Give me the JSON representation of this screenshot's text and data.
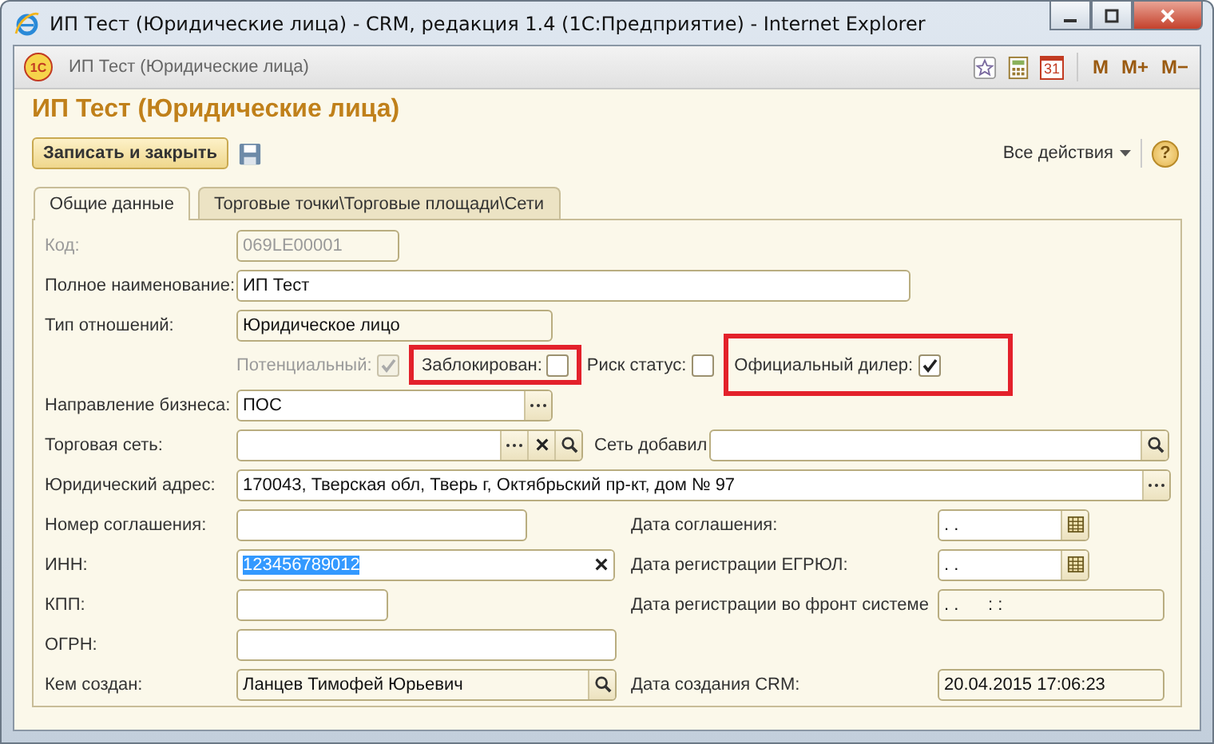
{
  "window": {
    "title": "ИП Тест (Юридические лица) - CRM, редакция 1.4 (1С:Предприятие) - Internet Explorer"
  },
  "app_bar": {
    "logo": "1С",
    "title": "ИП Тест (Юридические лица)",
    "calendar_day": "31",
    "memory_buttons": [
      "M",
      "M+",
      "M−"
    ]
  },
  "form": {
    "title": "ИП Тест (Юридические лица)",
    "save_button": "Записать и закрыть",
    "all_actions": "Все действия",
    "help": "?",
    "tabs": [
      {
        "label": "Общие данные",
        "selected": true
      },
      {
        "label": "Торговые точки\\Торговые площади\\Сети",
        "selected": false
      }
    ],
    "rows": [
      {
        "kind": "field",
        "label": "Код:",
        "label_disabled": true,
        "field": {
          "value": "069LE00001",
          "disabled": true
        }
      },
      {
        "kind": "field",
        "label": "Полное наименование:",
        "field": {
          "value": "ИП Тест"
        }
      },
      {
        "kind": "field",
        "label": "Тип отношений:",
        "field": {
          "value": "Юридическое лицо",
          "readonly": true
        }
      },
      {
        "kind": "flags",
        "flags": [
          {
            "label": "Потенциальный:",
            "checked": true,
            "disabled": true,
            "highlighted": false
          },
          {
            "label": "Заблокирован:",
            "checked": false,
            "disabled": false,
            "highlighted": true
          },
          {
            "label": "Риск статус:",
            "checked": false,
            "disabled": false,
            "highlighted": false
          },
          {
            "label": "Официальный дилер:",
            "checked": true,
            "disabled": false,
            "highlighted": true
          }
        ]
      },
      {
        "kind": "field",
        "label": "Направление бизнеса:",
        "field": {
          "value": "ПОС",
          "buttons": [
            {
              "kind": "select"
            }
          ]
        }
      },
      {
        "kind": "field",
        "label": "Торговая сеть:",
        "field": {
          "buttons": [
            {
              "kind": "select"
            },
            {
              "kind": "clear"
            },
            {
              "kind": "search"
            }
          ]
        },
        "right": {
          "label": "Сеть добавил",
          "field": {
            "buttons": [
              {
                "kind": "search"
              }
            ]
          }
        }
      },
      {
        "kind": "field",
        "label": "Юридический адрес:",
        "field": {
          "value": "170043, Тверская обл, Тверь г, Октябрьский пр-кт, дом № 97",
          "buttons": [
            {
              "kind": "select"
            }
          ]
        }
      },
      {
        "kind": "field",
        "label": "Номер соглашения:",
        "field": {},
        "right": {
          "label": "Дата соглашения:",
          "field": {
            "value": ". .",
            "buttons": [
              {
                "kind": "calendar"
              }
            ]
          }
        }
      },
      {
        "kind": "field",
        "label": "ИНН:",
        "field": {
          "value": "123456789012",
          "text_selected": true,
          "buttons": [
            {
              "kind": "clear"
            }
          ]
        },
        "right": {
          "label": "Дата регистрации ЕГРЮЛ:",
          "field": {
            "value": ". .",
            "buttons": [
              {
                "kind": "calendar"
              }
            ]
          }
        }
      },
      {
        "kind": "field",
        "label": "КПП:",
        "field": {},
        "right": {
          "label": "Дата регистрации во фронт системе",
          "field": {
            "value": ". .      : :",
            "readonly": true
          }
        }
      },
      {
        "kind": "field",
        "label": "ОГРН:",
        "field": {}
      },
      {
        "kind": "field",
        "label": "Кем создан:",
        "field": {
          "value": "Ланцев Тимофей Юрьевич",
          "readonly": true,
          "buttons": [
            {
              "kind": "search"
            }
          ]
        },
        "right": {
          "label": "Дата создания CRM:",
          "field": {
            "value": "20.04.2015 17:06:23",
            "readonly": true
          }
        }
      }
    ]
  }
}
